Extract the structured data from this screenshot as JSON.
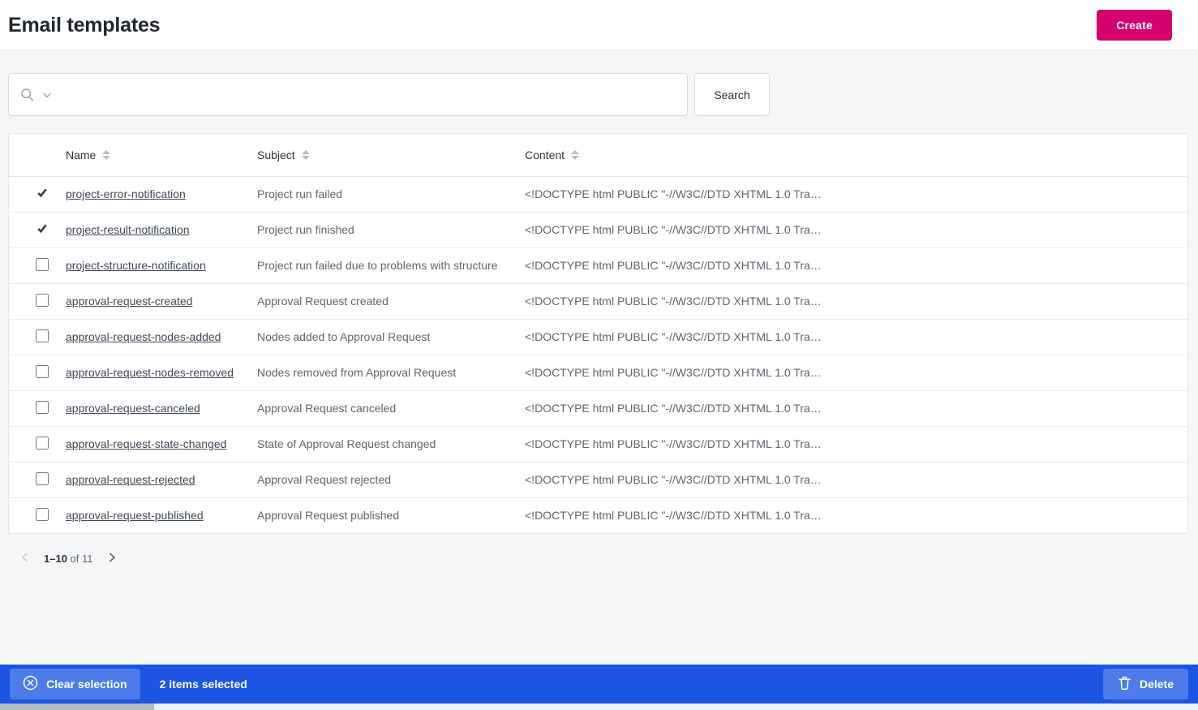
{
  "header": {
    "title": "Email templates",
    "create_label": "Create"
  },
  "search": {
    "value": "",
    "placeholder": "",
    "search_icon": "search-icon",
    "dropdown_icon": "chevron-down-icon",
    "button_label": "Search"
  },
  "table": {
    "columns": [
      {
        "key": "check",
        "label": "",
        "sortable": false
      },
      {
        "key": "name",
        "label": "Name",
        "sortable": true
      },
      {
        "key": "subject",
        "label": "Subject",
        "sortable": true
      },
      {
        "key": "content",
        "label": "Content",
        "sortable": true
      }
    ],
    "rows": [
      {
        "selected": true,
        "name": "project-error-notification",
        "subject": "Project run failed",
        "content": "<!DOCTYPE html PUBLIC \"-//W3C//DTD XHTML 1.0 Tra…"
      },
      {
        "selected": true,
        "name": "project-result-notification",
        "subject": "Project run finished",
        "content": "<!DOCTYPE html PUBLIC \"-//W3C//DTD XHTML 1.0 Tra…"
      },
      {
        "selected": false,
        "name": "project-structure-notification",
        "subject": "Project run failed due to problems with structure",
        "content": "<!DOCTYPE html PUBLIC \"-//W3C//DTD XHTML 1.0 Tra…"
      },
      {
        "selected": false,
        "name": "approval-request-created",
        "subject": "Approval Request created",
        "content": "<!DOCTYPE html PUBLIC \"-//W3C//DTD XHTML 1.0 Tra…"
      },
      {
        "selected": false,
        "name": "approval-request-nodes-added",
        "subject": "Nodes added to Approval Request",
        "content": "<!DOCTYPE html PUBLIC \"-//W3C//DTD XHTML 1.0 Tra…"
      },
      {
        "selected": false,
        "name": "approval-request-nodes-removed",
        "subject": "Nodes removed from Approval Request",
        "content": "<!DOCTYPE html PUBLIC \"-//W3C//DTD XHTML 1.0 Tra…"
      },
      {
        "selected": false,
        "name": "approval-request-canceled",
        "subject": "Approval Request canceled",
        "content": "<!DOCTYPE html PUBLIC \"-//W3C//DTD XHTML 1.0 Tra…"
      },
      {
        "selected": false,
        "name": "approval-request-state-changed",
        "subject": "State of Approval Request changed",
        "content": "<!DOCTYPE html PUBLIC \"-//W3C//DTD XHTML 1.0 Tra…"
      },
      {
        "selected": false,
        "name": "approval-request-rejected",
        "subject": "Approval Request rejected",
        "content": "<!DOCTYPE html PUBLIC \"-//W3C//DTD XHTML 1.0 Tra…"
      },
      {
        "selected": false,
        "name": "approval-request-published",
        "subject": "Approval Request published",
        "content": "<!DOCTYPE html PUBLIC \"-//W3C//DTD XHTML 1.0 Tra…"
      }
    ]
  },
  "pagination": {
    "range_prefix": "1–10",
    "range_suffix": "of 11",
    "prev_icon": "chevron-left-icon",
    "next_icon": "chevron-right-icon",
    "prev_enabled": false,
    "next_enabled": true
  },
  "action_bar": {
    "clear_label": "Clear selection",
    "clear_icon": "circle-x-icon",
    "selected_text": "2 items selected",
    "delete_label": "Delete",
    "delete_icon": "trash-icon"
  },
  "colors": {
    "accent_create": "#d6006e",
    "action_bar": "#1c55e3",
    "action_button": "#4d7bea",
    "page_background": "#f4f6f8"
  }
}
